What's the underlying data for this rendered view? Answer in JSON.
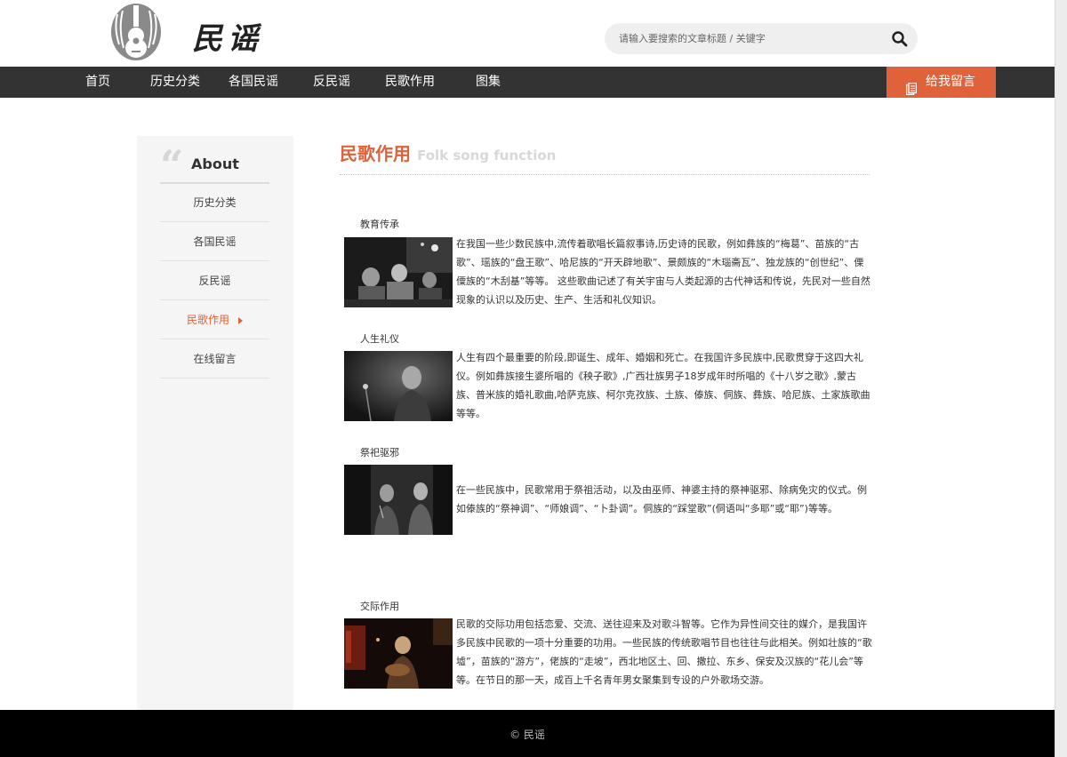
{
  "header": {
    "logo_text": "民谣",
    "search_placeholder": "请输入要搜索的文章标题 / 关键字"
  },
  "nav": {
    "items": [
      "首页",
      "历史分类",
      "各国民谣",
      "反民谣",
      "民歌作用",
      "图集"
    ],
    "cta_label": "给我留言"
  },
  "sidebar": {
    "title": "About",
    "items": [
      "历史分类",
      "各国民谣",
      "反民谣",
      "民歌作用",
      "在线留言"
    ],
    "active_index": 3
  },
  "page": {
    "title_cn": "民歌作用",
    "title_en": "Folk song function"
  },
  "sections": [
    {
      "title": "教育传承",
      "text": "在我国一些少数民族中,流传着歌唱长篇叙事诗,历史诗的民歌，例如彝族的“梅葛”、苗族的“古歌”、瑶族的“盘王歌”、哈尼族的“开天辟地歌”、景颇族的“木瑙斋瓦”、独龙族的“创世纪”、傈僳族的“木刮基”等等。 这些歌曲记述了有关宇宙与人类起源的古代神话和传说，先民对一些自然现象的认识以及历史、生产、生活和礼仪知识。"
    },
    {
      "title": "人生礼仪",
      "text": "人生有四个最重要的阶段,即诞生、成年、婚姻和死亡。在我国许多民族中,民歌贯穿于这四大礼仪。例如彝族接生婆所唱的《秧子歌》,广西壮族男子18岁成年时所唱的《十八岁之歌》,蒙古族、普米族的婚礼歌曲,哈萨克族、柯尔克孜族、土族、傣族、侗族、彝族、哈尼族、土家族歌曲等等。"
    },
    {
      "title": "祭祀驱邪",
      "text": "在一些民族中，民歌常用于祭祖活动，以及由巫师、神婆主持的祭神驱邪、除病免灾的仪式。例如傣族的“祭神调”、“师娘调”、“卜卦调”。侗族的“踩堂歌”(侗语叫“多耶”或“耶”)等等。"
    },
    {
      "title": "交际作用",
      "text": "民歌的交际功用包括恋爱、交流、送往迎来及对歌斗智等。它作为异性间交往的媒介，是我国许多民族中民歌的一项十分重要的功用。一些民族的传统歌唱节目也往往与此相关。例如壮族的“歌墟”，苗族的“游方”，佬族的“走坡”，西北地区土、回、撒拉、东乡、保安及汉族的“花儿会”等等。在节日的那一天，成百上千名青年男女聚集到专设的户外歌场交游。"
    }
  ],
  "footer": {
    "text": "©  民谣"
  },
  "colors": {
    "accent": "#e0623a",
    "nav_bg": "#333333",
    "footer_bg": "#000000",
    "sidebar_bg": "#f5f5f5"
  }
}
